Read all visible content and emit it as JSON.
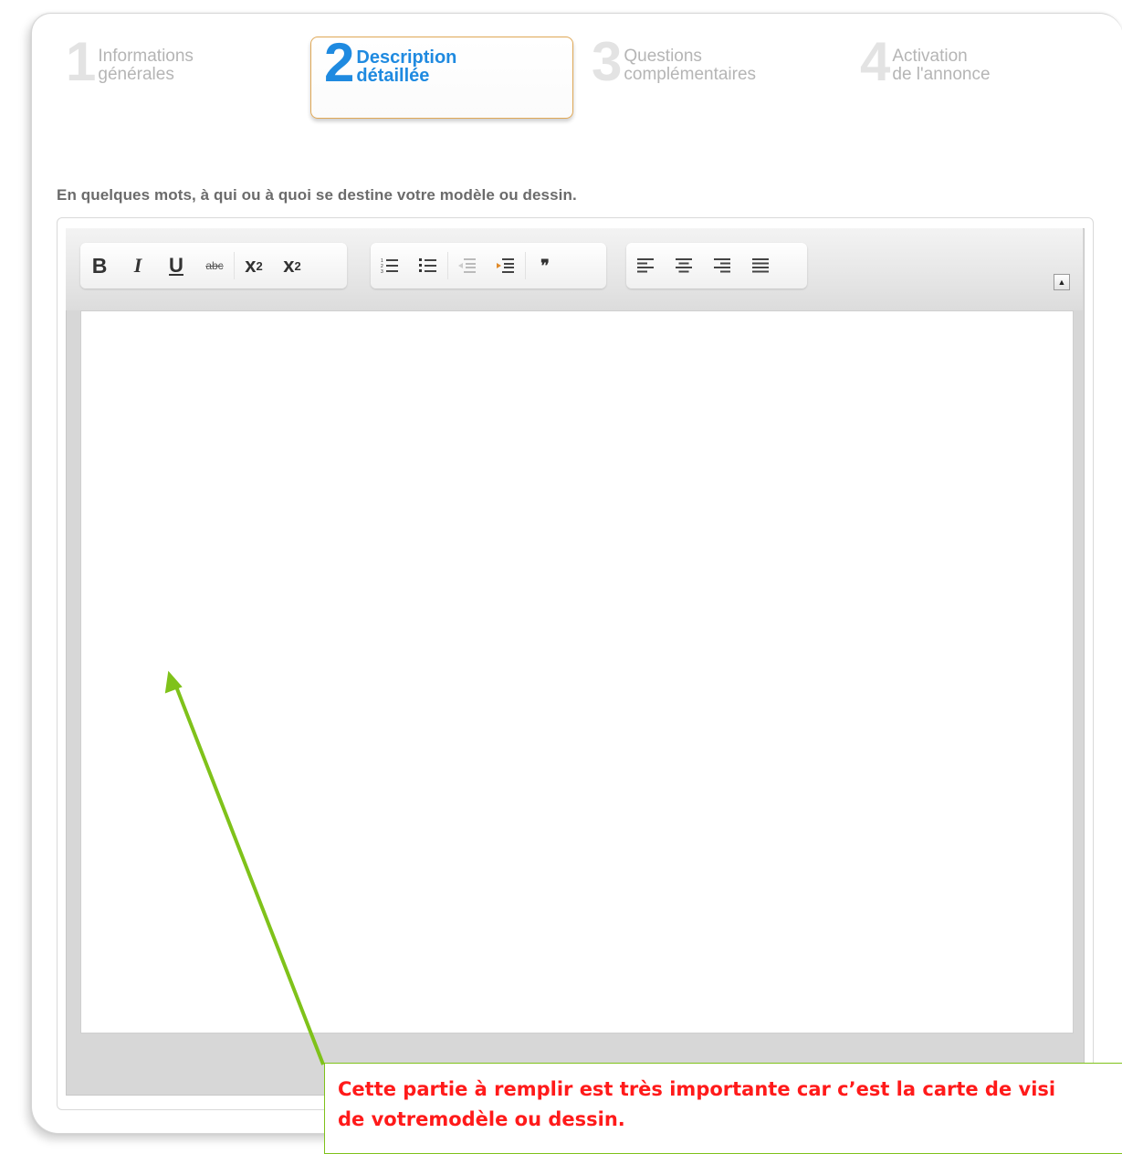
{
  "steps": [
    {
      "number": "1",
      "line1": "Informations",
      "line2": "générales",
      "state": "inactive"
    },
    {
      "number": "2",
      "line1": "Description",
      "line2": "détaillée",
      "state": "active"
    },
    {
      "number": "3",
      "line1": "Questions",
      "line2": "complémentaires",
      "state": "inactive"
    },
    {
      "number": "4",
      "line1": "Activation",
      "line2": "de l'annonce",
      "state": "inactive"
    }
  ],
  "prompt": "En quelques mots, à qui ou à quoi se destine votre modèle ou dessin.",
  "toolbar": {
    "bold": "B",
    "italic": "I",
    "underline": "U",
    "strike": "abc",
    "subscript": "x",
    "subscript_small": "2",
    "superscript": "x",
    "superscript_small": "2",
    "blockquote": "❞",
    "icons": [
      "bold-icon",
      "italic-icon",
      "underline-icon",
      "strikethrough-icon",
      "subscript-icon",
      "superscript-icon",
      "numbered-list-icon",
      "bullet-list-icon",
      "outdent-icon",
      "indent-icon",
      "blockquote-icon",
      "align-left-icon",
      "align-center-icon",
      "align-right-icon",
      "align-justify-icon",
      "collapse-toolbar-icon"
    ]
  },
  "editor": {
    "content": ""
  },
  "annotation": {
    "line1": "Cette partie à remplir est très importante car c’est la carte de visi",
    "line2": "de votremodèle ou dessin.",
    "text_color": "#ff1a1a",
    "arrow_color": "#7fc21a"
  },
  "colors": {
    "active_step": "#1f8ae0",
    "active_border": "#e0a856",
    "inactive_step": "#b5b5b5"
  }
}
